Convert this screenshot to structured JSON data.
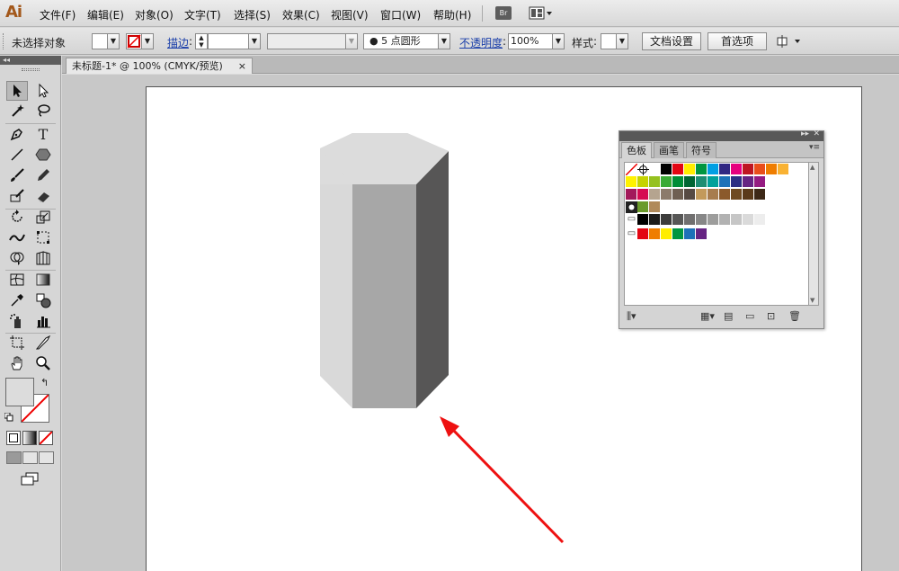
{
  "app": {
    "logo": "Ai"
  },
  "menu": [
    "文件(F)",
    "编辑(E)",
    "对象(O)",
    "文字(T)",
    "选择(S)",
    "效果(C)",
    "视图(V)",
    "窗口(W)",
    "帮助(H)"
  ],
  "menu_bridge": "Br",
  "control_bar": {
    "selection_status": "未选择对象",
    "stroke_label": "描边",
    "brush_value": "5 点圆形",
    "opacity_label": "不透明度",
    "opacity_value": "100%",
    "style_label": "样式",
    "doc_setup_button": "文档设置",
    "preferences_button": "首选项"
  },
  "document_tab": {
    "title": "未标题-1* @ 100% (CMYK/预览)",
    "close": "×"
  },
  "swatches_panel": {
    "tabs": [
      "色板",
      "画笔",
      "符号"
    ],
    "active_tab": "色板",
    "rows": [
      [
        "#ffffff",
        "#000000",
        "#e30613",
        "#ffed00",
        "#009640",
        "#009fe3",
        "#312783",
        "#e6007e",
        "#be1622",
        "#e94e1b",
        "#ef7d00",
        "#f9b233"
      ],
      [
        "#fff200",
        "#c5d300",
        "#95c11f",
        "#3aaa35",
        "#008d36",
        "#006633",
        "#1d8e73",
        "#00a19a",
        "#1d71b8",
        "#2d2e83",
        "#662483",
        "#951b81"
      ],
      [
        "#a3195b",
        "#d60b52",
        "#b5a48f",
        "#8c7b6b",
        "#6f5f52",
        "#574a43",
        "#c39a5b",
        "#a77c4e",
        "#8b5a2b",
        "#6f4a21",
        "#5b3a1a",
        "#3d2817"
      ],
      [
        "#000000",
        "#1d1d1b",
        "#3c3c3b",
        "#575756",
        "#706f6f",
        "#878787",
        "#9d9d9c",
        "#b2b2b2",
        "#c6c6c6",
        "#dadada",
        "#ededed"
      ],
      [
        "#e30613",
        "#ef7d00",
        "#ffed00",
        "#009640",
        "#1d71b8",
        "#662483"
      ]
    ]
  }
}
